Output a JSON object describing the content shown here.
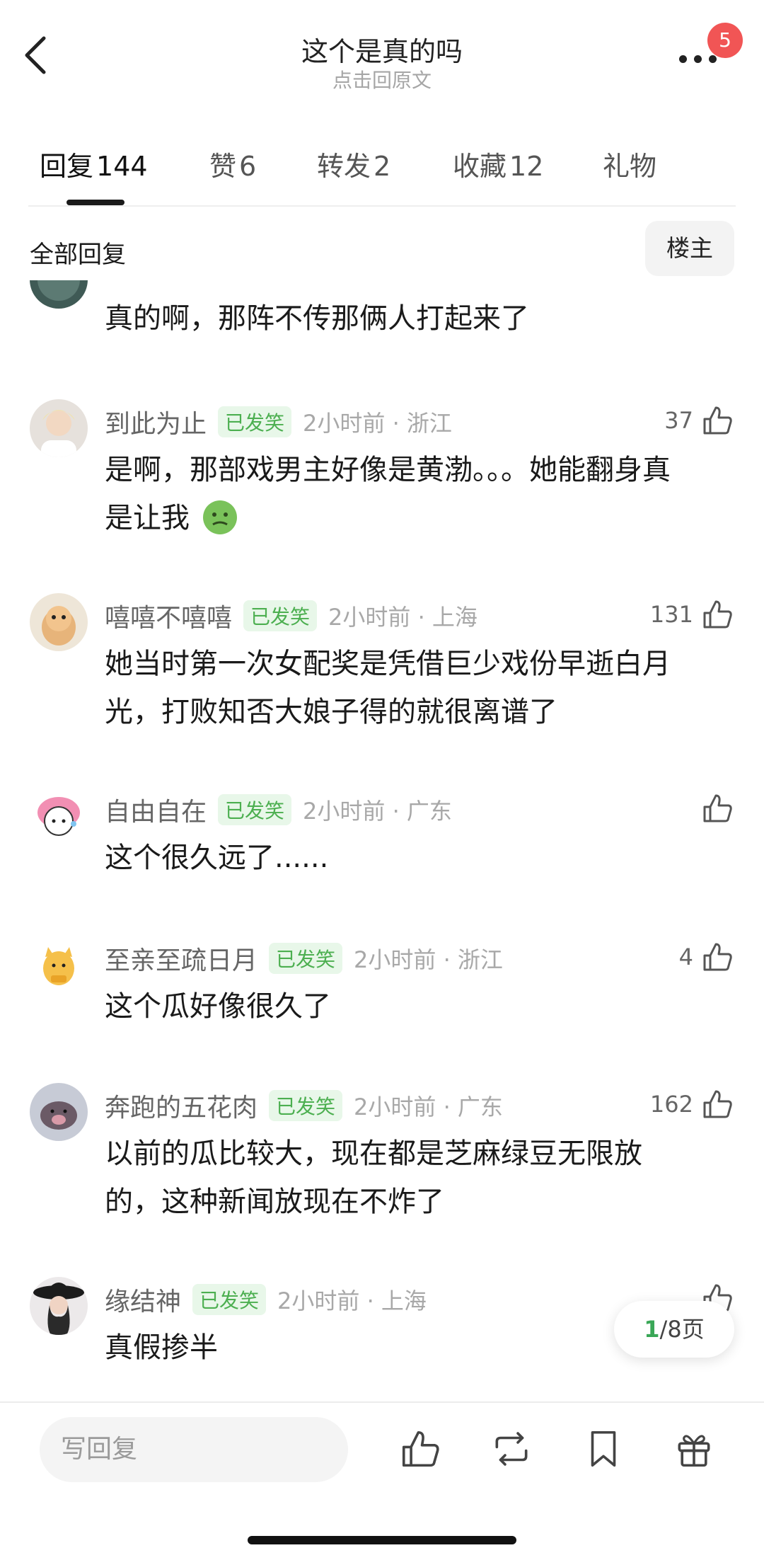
{
  "header": {
    "title": "这个是真的吗",
    "subtitle": "点击回原文",
    "badge_count": "5"
  },
  "tabs": [
    {
      "label": "回复",
      "count": "144",
      "active": true
    },
    {
      "label": "赞",
      "count": "6"
    },
    {
      "label": "转发",
      "count": "2"
    },
    {
      "label": "收藏",
      "count": "12"
    },
    {
      "label": "礼物",
      "count": ""
    }
  ],
  "filter": {
    "label": "全部回复",
    "owner_button": "楼主"
  },
  "partial_comment": {
    "text": "真的啊，那阵不传那俩人打起来了"
  },
  "comments": [
    {
      "name": "到此为止",
      "tag": "已发笑",
      "meta": "2小时前 · 浙江",
      "likes": "37",
      "lines": [
        "是啊，那部戏男主好像是黄渤。。。她能翻身真",
        "是让我"
      ],
      "emoji": "nauseated-face"
    },
    {
      "name": "嘻嘻不嘻嘻",
      "tag": "已发笑",
      "meta": "2小时前 · 上海",
      "likes": "131",
      "lines": [
        "她当时第一次女配奖是凭借巨少戏份早逝白月",
        "光，打败知否大娘子得的就很离谱了"
      ]
    },
    {
      "name": "自由自在",
      "tag": "已发笑",
      "meta": "2小时前 · 广东",
      "likes": "",
      "lines": [
        "这个很久远了......"
      ]
    },
    {
      "name": "至亲至疏日月",
      "tag": "已发笑",
      "meta": "2小时前 · 浙江",
      "likes": "4",
      "lines": [
        "这个瓜好像很久了"
      ]
    },
    {
      "name": "奔跑的五花肉",
      "tag": "已发笑",
      "meta": "2小时前 · 广东",
      "likes": "162",
      "lines": [
        "以前的瓜比较大，现在都是芝麻绿豆无限放",
        "的，这种新闻放现在不炸了"
      ]
    },
    {
      "name": "缘结神",
      "tag": "已发笑",
      "meta": "2小时前 · 上海",
      "likes": "",
      "lines": [
        "真假掺半"
      ]
    }
  ],
  "pager": {
    "current": "1",
    "total_suffix": "/8页"
  },
  "bottom_bar": {
    "reply_placeholder": "写回复",
    "icons": [
      "like-icon",
      "repost-icon",
      "bookmark-icon",
      "gift-icon"
    ]
  },
  "colors": {
    "accent_green": "#3aa757",
    "tag_green": "#4caf50",
    "badge_red": "#f15555"
  }
}
